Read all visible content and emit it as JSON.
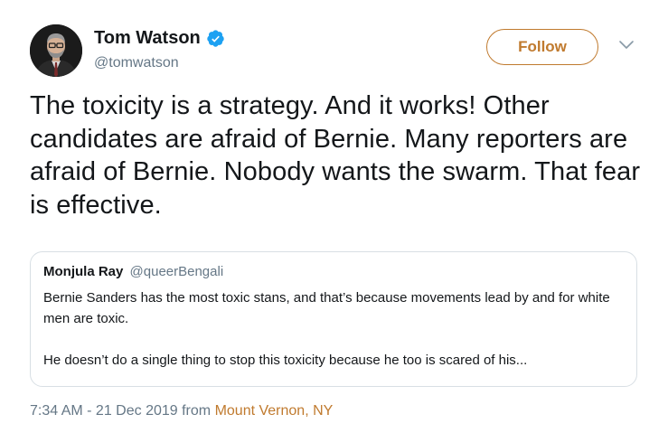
{
  "author": {
    "display_name": "Tom Watson",
    "handle": "@tomwatson",
    "verified": true
  },
  "actions": {
    "follow_label": "Follow"
  },
  "tweet": {
    "text": "The toxicity is a strategy. And it works! Other candidates are afraid of Bernie. Many reporters are afraid of Bernie. Nobody wants the swarm. That fear is effective."
  },
  "quoted_tweet": {
    "display_name": "Monjula Ray",
    "handle": "@queerBengali",
    "paragraph_1": "Bernie Sanders has the most toxic stans, and that’s because movements lead by and for white men are toxic.",
    "paragraph_2": "He doesn’t do a single thing to stop this toxicity because he too is scared of his..."
  },
  "meta": {
    "timestamp": "7:34 AM - 21 Dec 2019",
    "from_word": "from",
    "location": "Mount Vernon, NY"
  },
  "icons": {
    "verified": "verified-badge-icon",
    "menu": "chevron-down-icon"
  },
  "colors": {
    "accent": "#c07a2e",
    "verified_blue": "#1da1f2",
    "secondary_text": "#657786",
    "border": "#d8dfe4"
  }
}
